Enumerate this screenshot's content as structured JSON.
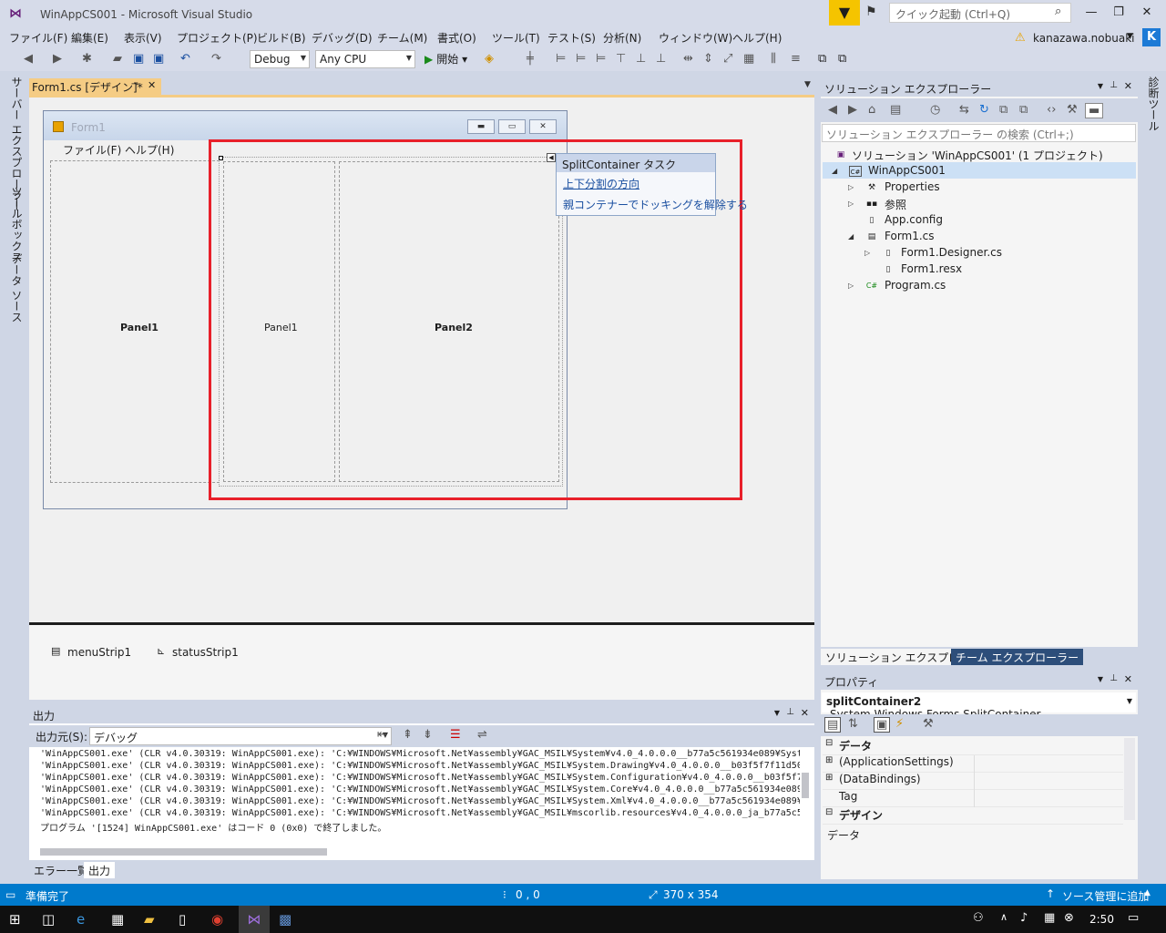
{
  "window": {
    "title": "WinAppCS001 - Microsoft Visual Studio",
    "quick_launch_placeholder": "クイック起動 (Ctrl+Q)",
    "user": "kanazawa.nobuaki",
    "avatar": "K"
  },
  "menu": [
    "ファイル(F)",
    "編集(E)",
    "表示(V)",
    "プロジェクト(P)",
    "ビルド(B)",
    "デバッグ(D)",
    "チーム(M)",
    "書式(O)",
    "ツール(T)",
    "テスト(S)",
    "分析(N)",
    "ウィンドウ(W)",
    "ヘルプ(H)"
  ],
  "toolbar": {
    "config": "Debug",
    "platform": "Any CPU",
    "start": "開始"
  },
  "left_rail": {
    "server_explorer": "サーバー エクスプローラー",
    "toolbox": "ツールボックス",
    "data_sources": "データ ソース"
  },
  "right_rail": {
    "diagnostic_tools": "診断ツール"
  },
  "doc_tab": {
    "label": "Form1.cs [デザイン]*"
  },
  "form": {
    "title": "Form1",
    "menu_file": "ファイル(F)",
    "menu_help": "ヘルプ(H)",
    "outer_panel1": "Panel1",
    "inner_panel1": "Panel1",
    "inner_panel2": "Panel2"
  },
  "smart_tag": {
    "title": "SplitContainer タスク",
    "link1": "上下分割の方向",
    "link2": "親コンテナーでドッキングを解除する"
  },
  "tray": {
    "item1": "menuStrip1",
    "item2": "statusStrip1"
  },
  "solution_explorer": {
    "title": "ソリューション エクスプローラー",
    "search_placeholder": "ソリューション エクスプローラー の検索 (Ctrl+;)",
    "nodes": [
      "ソリューション 'WinAppCS001' (1 プロジェクト)",
      "WinAppCS001",
      "Properties",
      "参照",
      "App.config",
      "Form1.cs",
      "Form1.Designer.cs",
      "Form1.resx",
      "Program.cs"
    ],
    "tab1": "ソリューション エクスプローラー",
    "tab2": "チーム エクスプローラー"
  },
  "properties": {
    "title": "プロパティ",
    "object_name": "splitContainer2",
    "object_type": "System.Windows.Forms.SplitContainer",
    "rows": [
      "データ",
      "(ApplicationSettings)",
      "(DataBindings)",
      "Tag",
      "デザイン"
    ],
    "description": "データ"
  },
  "output": {
    "title": "出力",
    "source_label": "出力元(S):",
    "source_value": "デバッグ",
    "lines": [
      "'WinAppCS001.exe' (CLR v4.0.30319: WinAppCS001.exe): 'C:¥WINDOWS¥Microsoft.Net¥assembly¥GAC_MSIL¥System¥v4.0_4.0.0.0__b77a5c561934e089¥Syst",
      "'WinAppCS001.exe' (CLR v4.0.30319: WinAppCS001.exe): 'C:¥WINDOWS¥Microsoft.Net¥assembly¥GAC_MSIL¥System.Drawing¥v4.0_4.0.0.0__b03f5f7f11d50",
      "'WinAppCS001.exe' (CLR v4.0.30319: WinAppCS001.exe): 'C:¥WINDOWS¥Microsoft.Net¥assembly¥GAC_MSIL¥System.Configuration¥v4.0_4.0.0.0__b03f5f7",
      "'WinAppCS001.exe' (CLR v4.0.30319: WinAppCS001.exe): 'C:¥WINDOWS¥Microsoft.Net¥assembly¥GAC_MSIL¥System.Core¥v4.0_4.0.0.0__b77a5c561934e089",
      "'WinAppCS001.exe' (CLR v4.0.30319: WinAppCS001.exe): 'C:¥WINDOWS¥Microsoft.Net¥assembly¥GAC_MSIL¥System.Xml¥v4.0_4.0.0.0__b77a5c561934e089¥",
      "'WinAppCS001.exe' (CLR v4.0.30319: WinAppCS001.exe): 'C:¥WINDOWS¥Microsoft.Net¥assembly¥GAC_MSIL¥mscorlib.resources¥v4.0_4.0.0.0_ja_b77a5c5",
      "プログラム '[1524] WinAppCS001.exe' はコード 0 (0x0) で終了しました。"
    ],
    "tab1": "エラー一覧",
    "tab2": "出力"
  },
  "status": {
    "ready": "準備完了",
    "position": "0 , 0",
    "size": "370 x 354",
    "source_control": "ソース管理に追加"
  },
  "taskbar": {
    "time": "2:50"
  },
  "colors": {
    "accent": "#007acc",
    "highlight_box": "#e8202a",
    "doc_tab": "#f5cc84"
  }
}
